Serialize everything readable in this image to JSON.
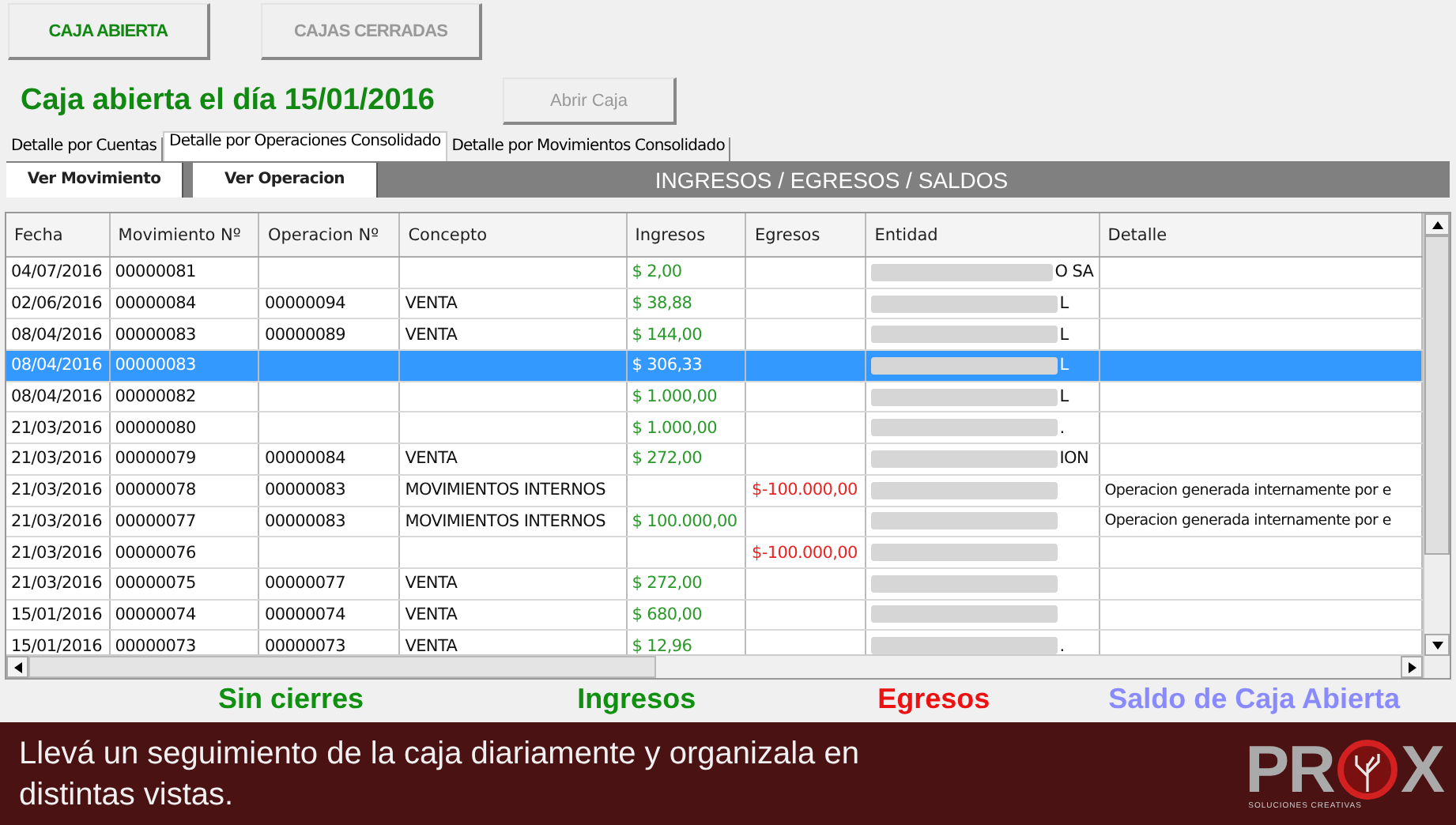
{
  "top_buttons": [
    {
      "label": "CAJA ABIERTA",
      "selected": true
    },
    {
      "label": "CAJAS CERRADAS",
      "selected": false
    }
  ],
  "heading": "Caja abierta el día 15/01/2016",
  "open_button": {
    "label": "Abrir Caja",
    "disabled": true
  },
  "tabs": [
    {
      "label": "Detalle por Cuentas",
      "selected": false
    },
    {
      "label": "Detalle por Operaciones Consolidado",
      "selected": true
    },
    {
      "label": "Detalle por Movimientos Consolidado",
      "selected": false
    }
  ],
  "toolbar": {
    "buttons": [
      "Ver Movimiento",
      "Ver Operacion"
    ],
    "title": "INGRESOS / EGRESOS / SALDOS"
  },
  "table": {
    "columns": [
      "Fecha",
      "Movimiento Nº",
      "Operacion Nº",
      "Concepto",
      "Ingresos",
      "Egresos",
      "Entidad",
      "Detalle"
    ],
    "rows": [
      {
        "fecha": "04/07/2016",
        "movimiento": "00000081",
        "ingresos": "$ 2,00",
        "entidad_blurred": true,
        "entidad": "O SA",
        "selected": false
      },
      {
        "fecha": "02/06/2016",
        "movimiento": "00000084",
        "operacion": "00000094",
        "concepto": "VENTA",
        "ingresos": "$ 38,88",
        "entidad_blurred": true,
        "entidad": "L",
        "selected": false
      },
      {
        "fecha": "08/04/2016",
        "movimiento": "00000083",
        "operacion": "00000089",
        "concepto": "VENTA",
        "ingresos": "$ 144,00",
        "entidad_blurred": true,
        "entidad": "L",
        "selected": false
      },
      {
        "fecha": "08/04/2016",
        "movimiento": "00000083",
        "ingresos": "$ 306,33",
        "entidad_blurred": true,
        "entidad": "L",
        "selected": true
      },
      {
        "fecha": "08/04/2016",
        "movimiento": "00000082",
        "ingresos": "$ 1.000,00",
        "entidad_blurred": true,
        "entidad": "L",
        "selected": false
      },
      {
        "fecha": "21/03/2016",
        "movimiento": "00000080",
        "ingresos": "$ 1.000,00",
        "entidad_blurred": true,
        "entidad": ".",
        "selected": false
      },
      {
        "fecha": "21/03/2016",
        "movimiento": "00000079",
        "operacion": "00000084",
        "concepto": "VENTA",
        "ingresos": "$ 272,00",
        "entidad_blurred": true,
        "entidad": "ION",
        "selected": false
      },
      {
        "fecha": "21/03/2016",
        "movimiento": "00000078",
        "operacion": "00000083",
        "concepto": "MOVIMIENTOS INTERNOS",
        "egresos": "$-100.000,00",
        "entidad_blurred": true,
        "detalle": "Operacion generada internamente por e",
        "selected": false
      },
      {
        "fecha": "21/03/2016",
        "movimiento": "00000077",
        "operacion": "00000083",
        "concepto": "MOVIMIENTOS INTERNOS",
        "ingresos": "$ 100.000,00",
        "entidad_blurred": true,
        "detalle": "Operacion generada internamente por e",
        "selected": false
      },
      {
        "fecha": "21/03/2016",
        "movimiento": "00000076",
        "egresos": "$-100.000,00",
        "entidad_blurred": true,
        "selected": false
      },
      {
        "fecha": "21/03/2016",
        "movimiento": "00000075",
        "operacion": "00000077",
        "concepto": "VENTA",
        "ingresos": "$ 272,00",
        "entidad_blurred": true,
        "selected": false
      },
      {
        "fecha": "15/01/2016",
        "movimiento": "00000074",
        "operacion": "00000074",
        "concepto": "VENTA",
        "ingresos": "$ 680,00",
        "entidad_blurred": true,
        "selected": false
      },
      {
        "fecha": "15/01/2016",
        "movimiento": "00000073",
        "operacion": "00000073",
        "concepto": "VENTA",
        "ingresos": "$ 12,96",
        "entidad_blurred": true,
        "entidad": ".",
        "selected": false
      }
    ]
  },
  "summary": [
    {
      "label": "Sin cierres",
      "color": "#109010"
    },
    {
      "label": "Ingresos",
      "color": "#109010"
    },
    {
      "label": "Egresos",
      "color": "#ee1111"
    },
    {
      "label": "Saldo de Caja Abierta",
      "color": "#8a8aff"
    }
  ],
  "banner": {
    "text": "Llevá un seguimiento de la caja diariamente y organizala en distintas vistas.",
    "logo_left": "PR",
    "logo_right": "X",
    "logo_tagline": "SOLUCIONES CREATIVAS"
  }
}
